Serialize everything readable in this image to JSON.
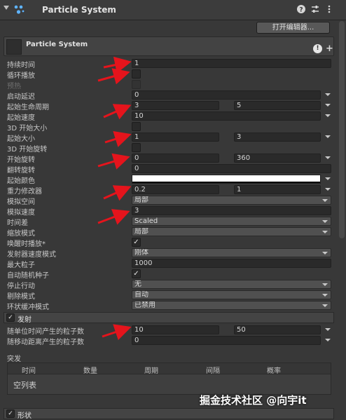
{
  "header": {
    "title": "Particle System",
    "help_icon": "help-icon",
    "settings_icon": "settings-icon",
    "menu_icon": "more-menu-icon"
  },
  "open_editor_label": "打开编辑器...",
  "module": {
    "name": "Particle System",
    "help_label": "!",
    "plus_label": "+"
  },
  "rows": {
    "duration": {
      "label": "持续时间",
      "value": "1"
    },
    "looping": {
      "label": "循环播放"
    },
    "prewarm": {
      "label": "预热"
    },
    "start_delay": {
      "label": "启动延迟",
      "value": "0"
    },
    "start_lifetime": {
      "label": "起始生命周期",
      "min": "3",
      "max": "5"
    },
    "start_speed": {
      "label": "起始速度",
      "value": "10"
    },
    "size_3d": {
      "label": "3D 开始大小"
    },
    "start_size": {
      "label": "起始大小",
      "min": "1",
      "max": "3"
    },
    "rotation_3d": {
      "label": "3D 开始旋转"
    },
    "start_rotation": {
      "label": "开始旋转",
      "min": "0",
      "max": "360"
    },
    "flip_rotation": {
      "label": "翻转旋转",
      "value": "0"
    },
    "start_color": {
      "label": "起始颜色",
      "color": "#ffffff"
    },
    "gravity": {
      "label": "重力修改器",
      "min": "0.2",
      "max": "1"
    },
    "sim_space": {
      "label": "模拟空间",
      "value": "局部"
    },
    "sim_speed": {
      "label": "模拟速度",
      "value": "3"
    },
    "delta_time": {
      "label": "时间差",
      "value": "Scaled"
    },
    "scaling_mode": {
      "label": "缩放模式",
      "value": "局部"
    },
    "play_on_awake": {
      "label": "唤醒时播放*"
    },
    "emitter_velocity": {
      "label": "发射器速度模式",
      "value": "刚体"
    },
    "max_particles": {
      "label": "最大粒子",
      "value": "1000"
    },
    "auto_seed": {
      "label": "自动随机种子"
    },
    "stop_action": {
      "label": "停止行动",
      "value": "无"
    },
    "culling_mode": {
      "label": "剔除模式",
      "value": "自动"
    },
    "ring_buffer": {
      "label": "环状缓冲模式",
      "value": "已禁用"
    }
  },
  "emission": {
    "section_label": "发射",
    "rate_time": {
      "label": "随单位时间产生的粒子数",
      "min": "10",
      "max": "50"
    },
    "rate_distance": {
      "label": "随移动距离产生的粒子数",
      "value": "0"
    },
    "bursts_label": "突发",
    "bursts_columns": [
      "时间",
      "数量",
      "周期",
      "间隔",
      "概率"
    ],
    "bursts_empty": "空列表"
  },
  "shape": {
    "section_label": "形状"
  },
  "checkmark": "✓",
  "watermark": "掘金技术社区 @向宇it",
  "colors": {
    "arrow": "#e5141c",
    "panel": "#383838"
  }
}
